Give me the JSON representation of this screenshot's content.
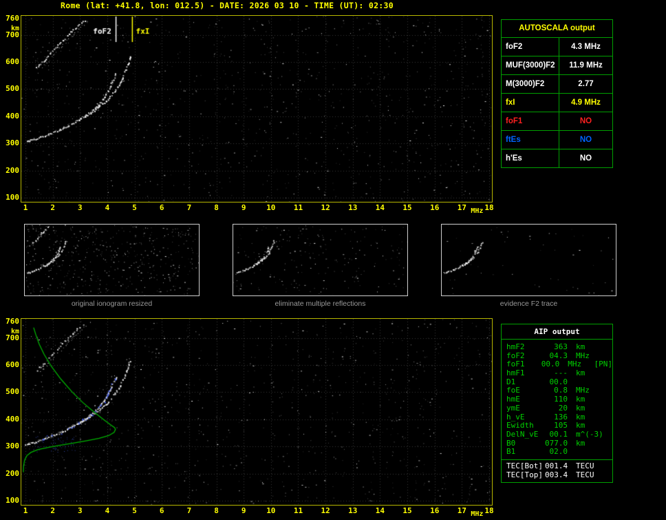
{
  "header": {
    "title": "Rome (lat: +41.8, lon: 012.5) - DATE: 2026 03 10 - TIME (UT): 02:30"
  },
  "colors": {
    "axis": "#ffff00",
    "plot_border": "#b8b800",
    "grid": "#3a3a3a",
    "table_border": "#00a000",
    "autoscala_title": "#ffff00",
    "aip_text": "#00d000",
    "profile": "#00b400",
    "fit_blue": "#4666ff",
    "white": "#ffffff",
    "red": "#ff2020",
    "blue": "#0064ff",
    "yellow": "#ffff00",
    "caption": "#9a9a9a"
  },
  "axes": {
    "x_ticks": [
      1,
      2,
      3,
      4,
      5,
      6,
      7,
      8,
      9,
      10,
      11,
      12,
      13,
      14,
      15,
      16,
      17,
      18
    ],
    "x_unit": "MHz",
    "y_ticks": [
      760,
      700,
      600,
      500,
      400,
      300,
      200,
      100
    ],
    "y_unit": "km",
    "x_range": [
      1,
      18
    ],
    "y_range": [
      100,
      760
    ]
  },
  "markers": {
    "foF2": {
      "label": "foF2",
      "freq": 4.3,
      "color": "#ffffff"
    },
    "fxI": {
      "label": "fxI",
      "freq": 4.9,
      "color": "#ffff00"
    }
  },
  "ionogram": {
    "type": "scatter",
    "f2_o_trace": [
      [
        1.0,
        308
      ],
      [
        1.3,
        316
      ],
      [
        1.6,
        326
      ],
      [
        1.9,
        338
      ],
      [
        2.2,
        350
      ],
      [
        2.5,
        364
      ],
      [
        2.8,
        380
      ],
      [
        3.1,
        398
      ],
      [
        3.4,
        420
      ],
      [
        3.65,
        442
      ],
      [
        3.85,
        466
      ],
      [
        4.0,
        492
      ],
      [
        4.12,
        518
      ],
      [
        4.22,
        540
      ],
      [
        4.28,
        552
      ],
      [
        4.31,
        562
      ]
    ],
    "f2_x_trace": [
      [
        2.9,
        386
      ],
      [
        3.3,
        408
      ],
      [
        3.7,
        436
      ],
      [
        4.0,
        462
      ],
      [
        4.2,
        488
      ],
      [
        4.4,
        515
      ],
      [
        4.55,
        545
      ],
      [
        4.68,
        575
      ],
      [
        4.78,
        605
      ],
      [
        4.85,
        628
      ]
    ],
    "echo_trace": [
      [
        1.35,
        575
      ],
      [
        1.6,
        600
      ],
      [
        1.85,
        628
      ],
      [
        2.1,
        655
      ],
      [
        2.35,
        680
      ],
      [
        2.6,
        706
      ],
      [
        2.85,
        730
      ],
      [
        3.1,
        752
      ],
      [
        3.25,
        760
      ]
    ],
    "echo2_trace": [
      [
        1.53,
        575
      ],
      [
        1.78,
        600
      ],
      [
        2.03,
        628
      ],
      [
        2.28,
        655
      ],
      [
        2.53,
        680
      ],
      [
        2.78,
        706
      ],
      [
        3.03,
        730
      ],
      [
        3.28,
        752
      ],
      [
        3.43,
        760
      ]
    ],
    "profile_trace": [
      [
        1.3,
        738
      ],
      [
        1.38,
        712
      ],
      [
        1.5,
        678
      ],
      [
        1.68,
        640
      ],
      [
        1.95,
        595
      ],
      [
        2.3,
        548
      ],
      [
        2.7,
        502
      ],
      [
        3.1,
        462
      ],
      [
        3.5,
        428
      ],
      [
        3.85,
        400
      ],
      [
        4.12,
        380
      ],
      [
        4.27,
        369
      ],
      [
        4.3,
        363
      ],
      [
        4.25,
        352
      ],
      [
        4.05,
        340
      ],
      [
        3.7,
        330
      ],
      [
        3.25,
        321
      ],
      [
        2.75,
        312
      ],
      [
        2.25,
        304
      ],
      [
        1.8,
        296
      ],
      [
        1.45,
        288
      ],
      [
        1.2,
        278
      ],
      [
        1.05,
        266
      ],
      [
        0.97,
        250
      ],
      [
        0.93,
        228
      ],
      [
        0.92,
        205
      ]
    ]
  },
  "thumbnails": [
    {
      "caption": "original ionogram resized",
      "noise": 500
    },
    {
      "caption": "eliminate multiple reflections",
      "noise": 210
    },
    {
      "caption": "evidence F2 trace",
      "noise": 55
    }
  ],
  "autoscala": {
    "title": "AUTOSCALA output",
    "rows": [
      {
        "label": "foF2",
        "value": "4.3 MHz",
        "color": "#ffffff"
      },
      {
        "label": "MUF(3000)F2",
        "value": "11.9 MHz",
        "color": "#ffffff"
      },
      {
        "label": "M(3000)F2",
        "value": "2.77",
        "color": "#ffffff"
      },
      {
        "label": "fxI",
        "value": "4.9 MHz",
        "color": "#ffff00"
      },
      {
        "label": "foF1",
        "value": "NO",
        "color": "#ff2020"
      },
      {
        "label": "ftEs",
        "value": "NO",
        "color": "#0064ff"
      },
      {
        "label": "h'Es",
        "value": "NO",
        "color": "#ffffff"
      }
    ]
  },
  "aip": {
    "title": "AIP output",
    "rows": [
      {
        "label": "hmF2",
        "value": "363",
        "unit": "km",
        "extra": ""
      },
      {
        "label": "foF2",
        "value": "04.3",
        "unit": "MHz",
        "extra": ""
      },
      {
        "label": "foF1",
        "value": "00.0",
        "unit": "MHz",
        "extra": "[PN]"
      },
      {
        "label": "hmF1",
        "value": "---",
        "unit": "km",
        "extra": ""
      },
      {
        "label": "D1",
        "value": "00.0",
        "unit": "",
        "extra": ""
      },
      {
        "label": "foE",
        "value": "0.8",
        "unit": "MHz",
        "extra": ""
      },
      {
        "label": "hmE",
        "value": "110",
        "unit": "km",
        "extra": ""
      },
      {
        "label": "ymE",
        "value": "20",
        "unit": "km",
        "extra": ""
      },
      {
        "label": "h_vE",
        "value": "136",
        "unit": "km",
        "extra": ""
      },
      {
        "label": "Ewidth",
        "value": "105",
        "unit": "km",
        "extra": ""
      },
      {
        "label": "DelN_vE",
        "value": "00.1",
        "unit": "m^(-3)",
        "extra": ""
      },
      {
        "label": "B0",
        "value": "077.0",
        "unit": "km",
        "extra": ""
      },
      {
        "label": "B1",
        "value": "02.0",
        "unit": "",
        "extra": ""
      }
    ],
    "tec_rows": [
      {
        "label": "TEC[Bot]",
        "value": "001.4",
        "unit": "TECU",
        "extra": ""
      },
      {
        "label": "TEC[Top]",
        "value": "003.4",
        "unit": "TECU",
        "extra": ""
      }
    ]
  }
}
